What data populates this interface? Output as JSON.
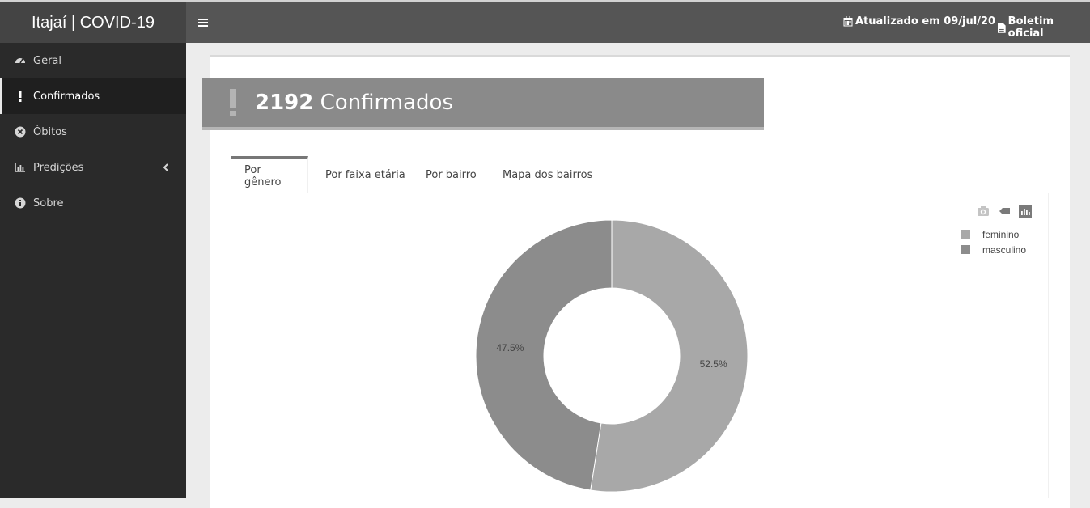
{
  "app": {
    "title": "Itajaí | COVID-19"
  },
  "sidebar": {
    "items": [
      {
        "label": "Geral",
        "icon": "dashboard-icon",
        "active": false
      },
      {
        "label": "Confirmados",
        "icon": "exclamation-icon",
        "active": true
      },
      {
        "label": "Óbitos",
        "icon": "times-circle-icon",
        "active": false
      },
      {
        "label": "Predições",
        "icon": "line-chart-icon",
        "active": false
      },
      {
        "label": "Sobre",
        "icon": "info-circle-icon",
        "active": false
      }
    ]
  },
  "header": {
    "updated_label": "Atualizado em 09/jul/20",
    "bulletin_label": "Boletim oficial"
  },
  "valuebox": {
    "value": "2192",
    "label": " Confirmados"
  },
  "tabs": [
    {
      "label": "Por gênero",
      "active": true
    },
    {
      "label": "Por faixa etária",
      "active": false
    },
    {
      "label": "Por bairro",
      "active": false
    },
    {
      "label": "Mapa dos bairros",
      "active": false
    }
  ],
  "colors": {
    "feminino": "#a8a8a8",
    "masculino": "#8c8c8c",
    "sidebar": "#2a2a2a",
    "header": "#555555"
  },
  "chart_data": {
    "type": "pie",
    "hole": true,
    "categories": [
      "feminino",
      "masculino"
    ],
    "values": [
      52.5,
      47.5
    ],
    "labels": [
      "52.5%",
      "47.5%"
    ],
    "legend": "top-right"
  }
}
